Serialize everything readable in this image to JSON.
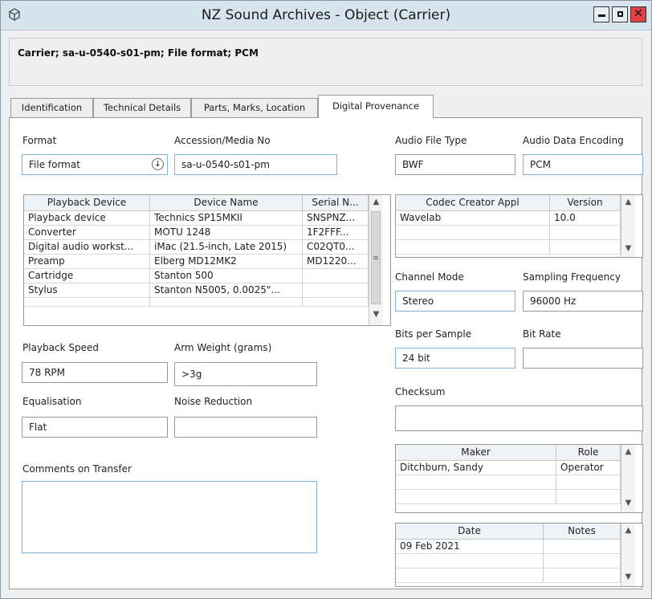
{
  "window": {
    "title": "NZ Sound Archives - Object (Carrier)",
    "app_icon": "cube-icon",
    "controls": [
      "minimize-icon",
      "maximize-icon",
      "close-icon"
    ],
    "close_color": "#e04343"
  },
  "header": {
    "summary": "Carrier; sa-u-0540-s01-pm; File format; PCM"
  },
  "tabs": [
    {
      "label": "Identification",
      "active": false
    },
    {
      "label": "Technical Details",
      "active": false
    },
    {
      "label": "Parts, Marks, Location",
      "active": false
    },
    {
      "label": "Digital Provenance",
      "active": true
    }
  ],
  "form": {
    "format_label": "Format",
    "format_value": "File format",
    "accession_label": "Accession/Media No",
    "accession_value": "sa-u-0540-s01-pm",
    "audio_file_type_label": "Audio File Type",
    "audio_file_type_value": "BWF",
    "audio_data_encoding_label": "Audio Data Encoding",
    "audio_data_encoding_value": "PCM",
    "channel_mode_label": "Channel Mode",
    "channel_mode_value": "Stereo",
    "sampling_frequency_label": "Sampling Frequency",
    "sampling_frequency_value": "96000 Hz",
    "bits_per_sample_label": "Bits per Sample",
    "bits_per_sample_value": "24 bit",
    "bit_rate_label": "Bit Rate",
    "bit_rate_value": "",
    "checksum_label": "Checksum",
    "checksum_value": "",
    "playback_speed_label": "Playback Speed",
    "playback_speed_value": "78 RPM",
    "arm_weight_label": "Arm Weight (grams)",
    "arm_weight_value": ">3g",
    "equalisation_label": "Equalisation",
    "equalisation_value": "Flat",
    "noise_reduction_label": "Noise Reduction",
    "noise_reduction_value": "",
    "comments_label": "Comments on Transfer",
    "comments_value": ""
  },
  "devices_table": {
    "headers": [
      "Playback Device",
      "Device Name",
      "Serial N..."
    ],
    "rows": [
      [
        "Playback device",
        "Technics SP15MKII",
        "SNSPNZ..."
      ],
      [
        "Converter",
        "MOTU 1248",
        "1F2FFF..."
      ],
      [
        "Digital audio workst...",
        "iMac (21.5-inch, Late 2015)",
        "C02QT0..."
      ],
      [
        "Preamp",
        "Elberg MD12MK2",
        "MD1220..."
      ],
      [
        "Cartridge",
        "Stanton 500",
        ""
      ],
      [
        "Stylus",
        "Stanton N5005, 0.0025\"...",
        ""
      ]
    ]
  },
  "codec_table": {
    "headers": [
      "Codec Creator Appl",
      "Version"
    ],
    "rows": [
      [
        "Wavelab",
        "10.0"
      ],
      [
        "",
        ""
      ]
    ]
  },
  "maker_table": {
    "headers": [
      "Maker",
      "Role"
    ],
    "rows": [
      [
        "Ditchburn, Sandy",
        "Operator"
      ],
      [
        "",
        ""
      ]
    ]
  },
  "date_table": {
    "headers": [
      "Date",
      "Notes"
    ],
    "rows": [
      [
        "09 Feb 2021",
        ""
      ],
      [
        "",
        ""
      ]
    ]
  }
}
